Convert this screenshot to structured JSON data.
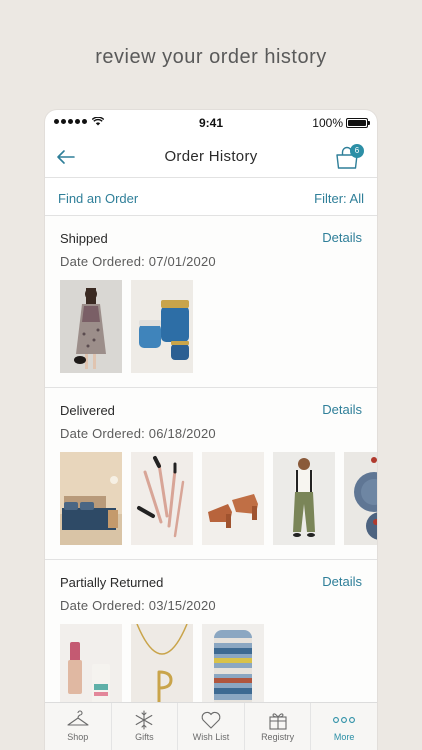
{
  "headline": "review your order history",
  "status_bar": {
    "time": "9:41",
    "battery": "100%"
  },
  "nav": {
    "title": "Order History",
    "bag_count": "6"
  },
  "actions": {
    "find_order": "Find an Order",
    "filter": "Filter: All"
  },
  "orders": [
    {
      "status": "Shipped",
      "details": "Details",
      "date": "Date Ordered: 07/01/2020"
    },
    {
      "status": "Delivered",
      "details": "Details",
      "date": "Date Ordered: 06/18/2020"
    },
    {
      "status": "Partially Returned",
      "details": "Details",
      "date": "Date Ordered: 03/15/2020"
    }
  ],
  "tabs": [
    {
      "label": "Shop",
      "icon": "hanger-icon"
    },
    {
      "label": "Gifts",
      "icon": "snowflake-icon"
    },
    {
      "label": "Wish List",
      "icon": "heart-icon"
    },
    {
      "label": "Registry",
      "icon": "gift-icon"
    },
    {
      "label": "More",
      "icon": "more-dots-icon",
      "active": true
    }
  ],
  "colors": {
    "accent": "#2c8fa6",
    "link": "#2f7f99",
    "background": "#ece8e3"
  }
}
